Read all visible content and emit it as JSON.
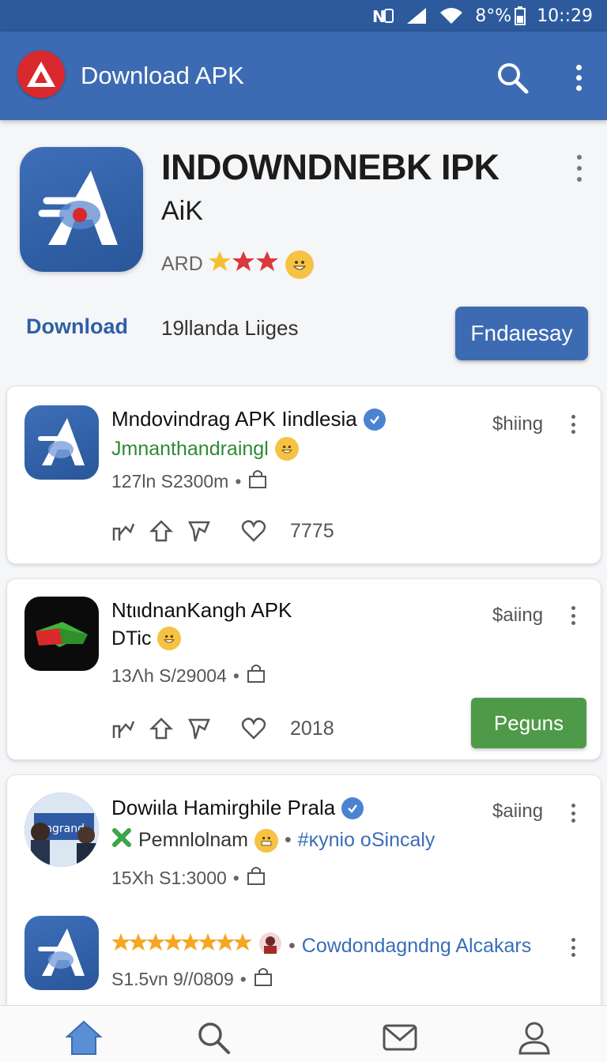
{
  "status_bar": {
    "battery": "8°%",
    "time": "10::29",
    "icons": [
      "nfc-icon",
      "signal-icon",
      "wifi-icon",
      "battery-icon"
    ]
  },
  "app_bar": {
    "title": "Download APK",
    "logo_icon": "app-logo-icon",
    "search_icon": "search-icon",
    "menu_icon": "more-vert-icon"
  },
  "hero": {
    "title": "INDOWNDNEBK IPK",
    "subtitle": "AiK",
    "rating_label": "ARD",
    "download_link": "Download",
    "stats": "19llanda Liiges",
    "button_label": "Fndaιesay"
  },
  "cards": [
    {
      "title": "Mndovindrag APK Iindlesia",
      "subtitle": "Jmnanthandraingl",
      "meta": "127ln S2300m",
      "status": "$hiing",
      "like_count": "7775",
      "verified": true
    },
    {
      "title": "NtιιdnanKangh APK",
      "subtitle": "DTic",
      "meta": "13Λh S/29004",
      "status": "$aiing",
      "like_count": "2018",
      "button_label": "Peguns"
    },
    {
      "title": "Dowiιla Hamirghile Prala",
      "subtitle": "Pemnlolnam",
      "tag": "#κynio oSincaly",
      "meta": "15Xh S1:3000",
      "status": "$aiing",
      "verified": true
    },
    {
      "subtitle": "Cowdondagndng Alcakars",
      "meta": "S1.5vn 9//0809",
      "stars": 8
    }
  ],
  "bottom_nav": {
    "items": [
      "home-icon",
      "search-icon",
      "mail-icon",
      "profile-icon"
    ]
  },
  "colors": {
    "primary": "#3c6bb3",
    "status_bar": "#2d5a9c",
    "accent_red": "#d9292e",
    "green": "#4f9a49",
    "verified": "#4b83d1"
  }
}
